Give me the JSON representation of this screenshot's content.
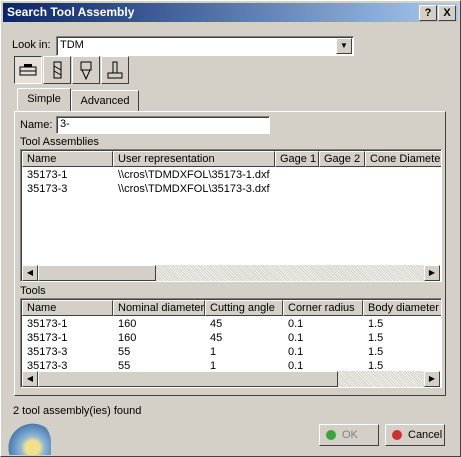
{
  "window": {
    "title": "Search Tool Assembly",
    "help_label": "?",
    "close_label": "X"
  },
  "lookin": {
    "label": "Look in:",
    "value": "TDM",
    "arrow": "▼"
  },
  "type_buttons": [
    {
      "icon": "tool-assembly-icon"
    },
    {
      "icon": "cutting-tool-icon"
    },
    {
      "icon": "drill-tool-icon"
    },
    {
      "icon": "holder-icon"
    }
  ],
  "tabs": [
    {
      "label": "Simple"
    },
    {
      "label": "Advanced"
    }
  ],
  "name_field": {
    "label": "Name:",
    "value": "3-"
  },
  "assemblies": {
    "title": "Tool Assemblies",
    "columns": [
      "Name",
      "User representation",
      "Gage 1",
      "Gage 2",
      "Cone Diameter"
    ],
    "rows": [
      [
        "35173-1",
        "\\\\cros\\TDMDXFOL\\35173-1.dxf"
      ],
      [
        "35173-3",
        "\\\\cros\\TDMDXFOL\\35173-3.dxf"
      ]
    ]
  },
  "tools": {
    "title": "Tools",
    "columns": [
      "Name",
      "Nominal diameter",
      "Cutting angle",
      "Corner radius",
      "Body diameter"
    ],
    "rows": [
      [
        "35173-1",
        "160",
        "45",
        "0.1",
        "1.5"
      ],
      [
        "35173-1",
        "160",
        "45",
        "0.1",
        "1.5"
      ],
      [
        "35173-3",
        "55",
        "1",
        "0.1",
        "1.5"
      ],
      [
        "35173-3",
        "55",
        "1",
        "0.1",
        "1.5"
      ]
    ]
  },
  "scroll": {
    "left": "◀",
    "right": "▶"
  },
  "status": "2 tool assembly(ies) found",
  "buttons": {
    "ok": "OK",
    "cancel": "Cancel"
  },
  "colors": {
    "ok_dot": "#3aa53a",
    "cancel_dot": "#d03030",
    "title_start": "#0a246a"
  }
}
